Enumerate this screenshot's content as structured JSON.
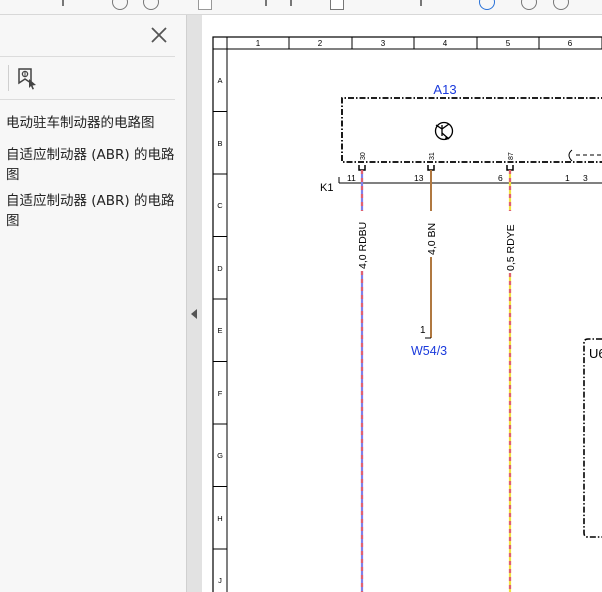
{
  "sidebar": {
    "bookmarks": [
      "电动驻车制动器的电路图",
      "自适应制动器 (ABR) 的电路图",
      "自适应制动器 (ABR) 的电路图"
    ]
  },
  "diagram": {
    "columns": [
      "1",
      "2",
      "3",
      "4",
      "5",
      "6"
    ],
    "rows": [
      "A",
      "B",
      "C",
      "D",
      "E",
      "F",
      "G",
      "H",
      "J"
    ],
    "component_a13": "A13",
    "connector_k1": "K1",
    "pins_top": [
      "30",
      "31",
      "87"
    ],
    "pins_bottom": [
      "11",
      "13",
      "6",
      "1",
      "3"
    ],
    "wires": [
      {
        "label": "4,0 RDBU",
        "color_a": "#e06070",
        "color_b": "#8080e8"
      },
      {
        "label": "4,0 BN",
        "color_a": "#b07840",
        "color_b": "#b07840"
      },
      {
        "label": "0,5 RDYE",
        "color_a": "#e06070",
        "color_b": "#f0e040"
      }
    ],
    "ground_pin": "1",
    "ground_label": "W54/3",
    "right_component": "U6",
    "component_text_color": "#1a3adc"
  }
}
